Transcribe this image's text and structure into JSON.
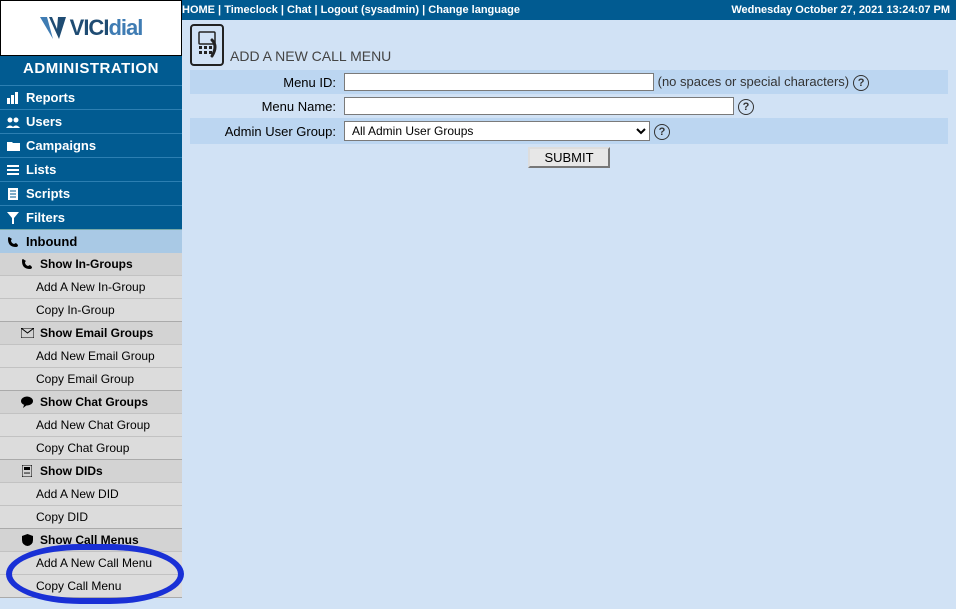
{
  "top": {
    "links": [
      "HOME",
      "Timeclock",
      "Chat",
      "Logout (sysadmin)",
      "Change language"
    ],
    "datetime": "Wednesday October 27, 2021 13:24:07 PM"
  },
  "brand": {
    "logo": "VICIdial",
    "admin": "ADMINISTRATION"
  },
  "nav": {
    "items": [
      {
        "icon": "chart-icon",
        "label": "Reports"
      },
      {
        "icon": "users-icon",
        "label": "Users"
      },
      {
        "icon": "folder-icon",
        "label": "Campaigns"
      },
      {
        "icon": "list-icon",
        "label": "Lists"
      },
      {
        "icon": "script-icon",
        "label": "Scripts"
      },
      {
        "icon": "filter-icon",
        "label": "Filters"
      },
      {
        "icon": "phone-icon",
        "label": "Inbound",
        "active": true
      }
    ]
  },
  "sub": {
    "groups": [
      {
        "icon": "phone-icon",
        "head": "Show In-Groups",
        "links": [
          "Add A New In-Group",
          "Copy In-Group"
        ]
      },
      {
        "icon": "mail-icon",
        "head": "Show Email Groups",
        "links": [
          "Add New Email Group",
          "Copy Email Group"
        ]
      },
      {
        "icon": "chat-bubble-icon",
        "head": "Show Chat Groups",
        "links": [
          "Add New Chat Group",
          "Copy Chat Group"
        ]
      },
      {
        "icon": "did-icon",
        "head": "Show DIDs",
        "links": [
          "Add A New DID",
          "Copy DID"
        ]
      },
      {
        "icon": "shield-icon",
        "head": "Show Call Menus",
        "links": [
          "Add A New Call Menu",
          "Copy Call Menu"
        ]
      }
    ]
  },
  "form": {
    "title": "ADD A NEW CALL MENU",
    "menu_id_label": "Menu ID:",
    "menu_id_value": "",
    "menu_id_note": "(no spaces or special characters)",
    "menu_name_label": "Menu Name:",
    "menu_name_value": "",
    "group_label": "Admin User Group:",
    "group_selected": "All Admin User Groups",
    "group_options": [
      "All Admin User Groups"
    ],
    "submit": "SUBMIT"
  }
}
